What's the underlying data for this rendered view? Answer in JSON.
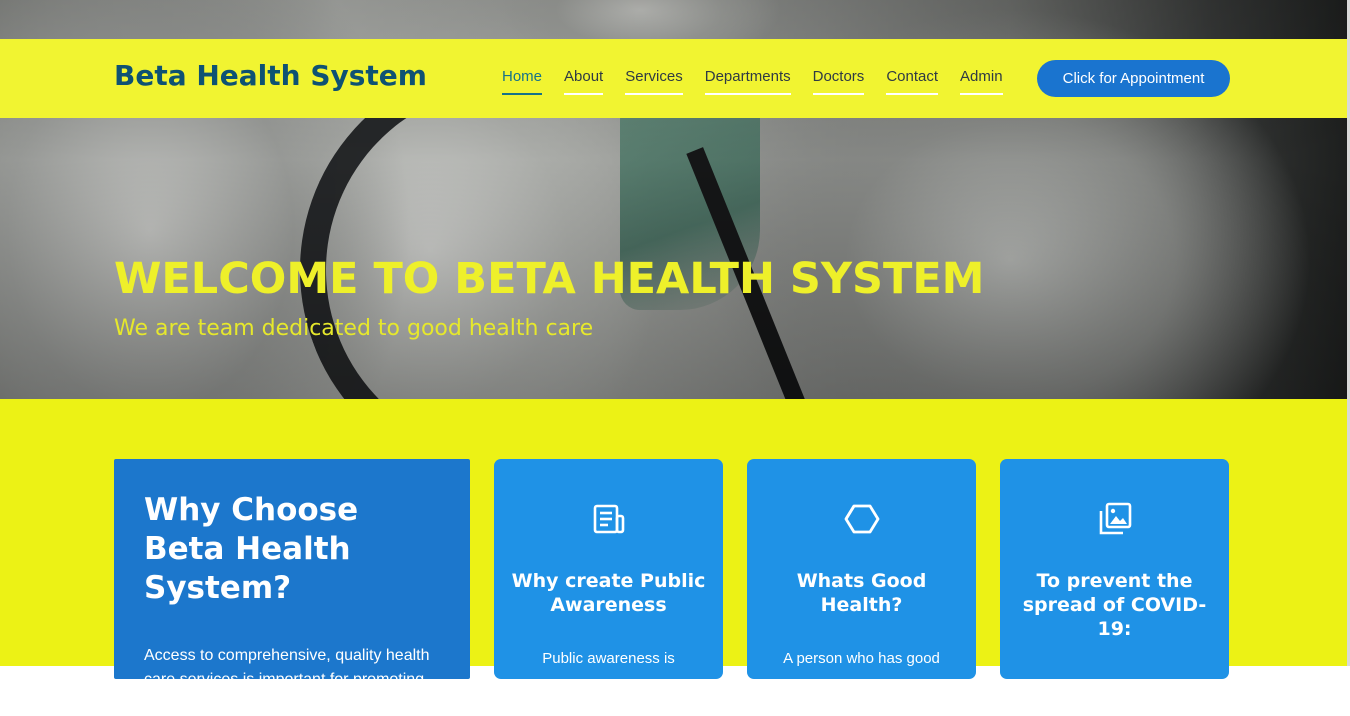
{
  "header": {
    "logo": "Beta Health System",
    "nav": [
      {
        "label": "Home"
      },
      {
        "label": "About"
      },
      {
        "label": "Services"
      },
      {
        "label": "Departments"
      },
      {
        "label": "Doctors"
      },
      {
        "label": "Contact"
      },
      {
        "label": "Admin"
      }
    ],
    "active_nav": "Home",
    "cta_label": "Click for Appointment"
  },
  "hero": {
    "title": "WELCOME TO BETA HEALTH SYSTEM",
    "subtitle": "We are team dedicated to good health care"
  },
  "why": {
    "title": "Why Choose Beta Health System?",
    "text": "Access to comprehensive, quality health care services is important for promoting and maintaining health,"
  },
  "cards": [
    {
      "icon": "receipt-icon",
      "title": "Why create Public Awareness",
      "text": "Public awareness is"
    },
    {
      "icon": "hexagon-icon",
      "title": "Whats Good Health?",
      "text": "A person who has good"
    },
    {
      "icon": "images-icon",
      "title": "To prevent the spread of COVID-19:",
      "text": ""
    }
  ],
  "colors": {
    "header_bg": "#f1f431",
    "section_bg": "#ecf215",
    "logo": "#0e5273",
    "accent": "#1a74cf",
    "card_bg": "#1f92e6",
    "why_bg": "#1c77cc",
    "hero_text": "#eef02a"
  }
}
